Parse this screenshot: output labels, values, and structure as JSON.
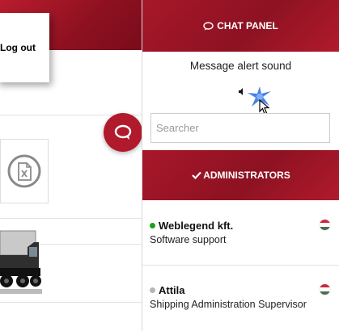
{
  "background_page": {
    "logout_label": "Log out"
  },
  "chat_panel": {
    "title": "CHAT PANEL",
    "alert_sound_label": "Message alert sound",
    "search_placeholder": "Searcher",
    "administrators_title": "ADMINISTRATORS",
    "administrators": [
      {
        "name": "Weblegend kft.",
        "role": "Software support",
        "status": "online",
        "status_color": "#1aa31a"
      },
      {
        "name": "Attila",
        "role": "Shipping Administration Supervisor",
        "status": "offline",
        "status_color": "#b5b5b5"
      }
    ]
  },
  "colors": {
    "brand_red": "#a8172a",
    "flag_red": "#ce2939",
    "flag_white": "#ffffff",
    "flag_green": "#477050"
  },
  "icons": [
    "chat-bubble-icon",
    "check-icon",
    "speaker-icon",
    "excel-file-icon",
    "truck-image",
    "hungary-flag-icon",
    "mouse-cursor-icon"
  ]
}
